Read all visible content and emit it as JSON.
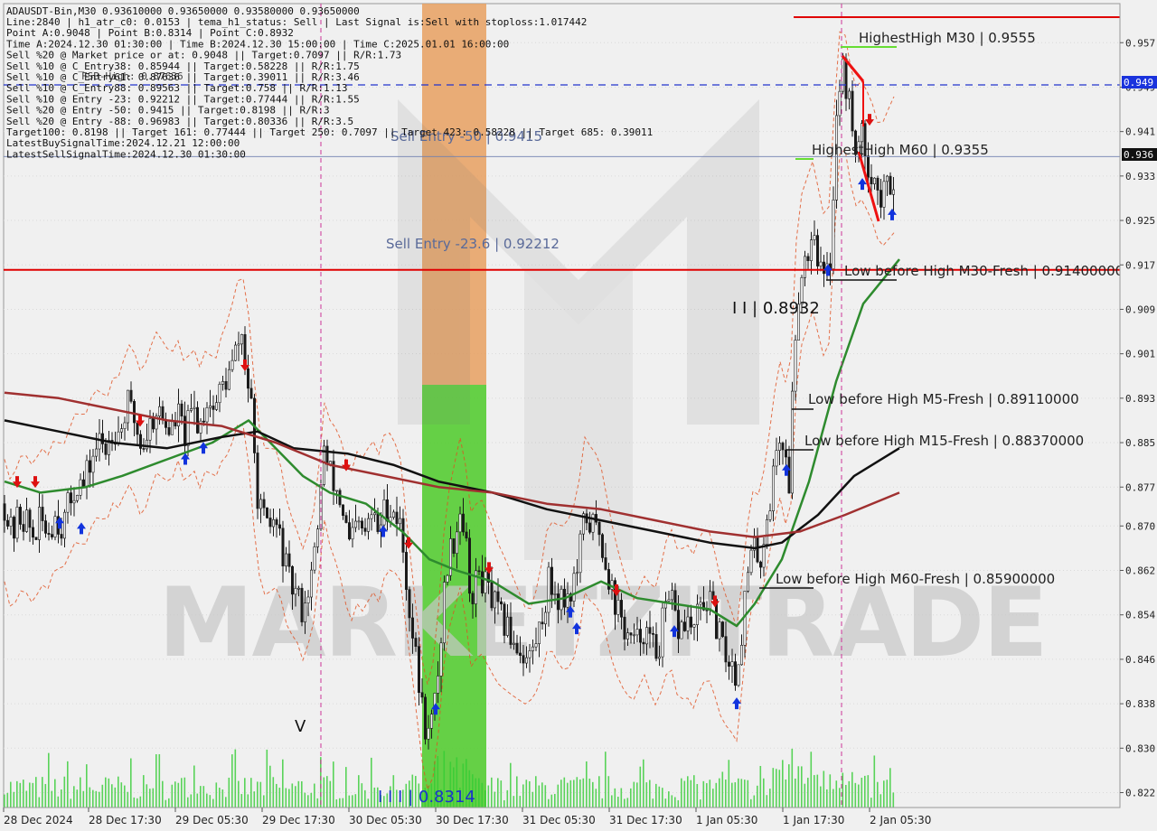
{
  "chart_header": {
    "symbol_line": "ADAUSDT-Bin,M30  0.93610000 0.93650000 0.93580000 0.93650000"
  },
  "info_lines": [
    "Line:2840 | h1_atr_c0: 0.0153 | tema_h1_status: Sell | Last Signal is:Sell with stoploss:1.017442",
    "Point A:0.9048 | Point B:0.8314 | Point C:0.8932",
    "Time A:2024.12.30 01:30:00 | Time B:2024.12.30 15:00:00 | Time C:2025.01.01 16:00:00",
    "Sell %20 @ Market price or at: 0.9048 || Target:0.7097 || R/R:1.73",
    "Sell %10 @ C_Entry38: 0.85944 || Target:0.58228 || R/R:1.75",
    "Sell %10 @ C_Entry61: 0.87636 || Target:0.39011 || R/R:3.46",
    "Sell %10 @ C_Entry88: 0.89563 || Target:0.758 || R/R:1.13",
    "Sell %10 @ Entry -23: 0.92212 || Target:0.77444 || R/R:1.55",
    "Sell %20 @ Entry -50: 0.9415 || Target:0.8198 || R/R:3",
    "Sell %20 @ Entry -88: 0.96983 || Target:0.80336 || R/R:3.5",
    "Target100: 0.8198 || Target 161: 0.77444 || Target 250: 0.7097 || Target 423: 0.58228 || Target 685: 0.39011",
    "LatestBuySignalTime:2024.12.21 12:00:00",
    "LatestSellSignalTime:2024.12.30 01:30:00"
  ],
  "overlap_text": "FSB-High: 0.87636",
  "watermark": "MARKETZITRADE",
  "annotations": {
    "highest_high_m30": "HighestHigh   M30 | 0.9555",
    "highest_high_m60": "HighestHigh   M60 | 0.9355",
    "sell_entry_50": "Sell Entry -50 | 0.9415",
    "sell_entry_23": "Sell Entry -23.6 | 0.92212",
    "low_before_high_m30": "Low before High   M30-Fresh | 0.91400000",
    "point_c": "I I | 0.8932",
    "low_before_high_m5": "Low before High   M5-Fresh | 0.89110000",
    "low_before_high_m15": "Low before High   M15-Fresh | 0.88370000",
    "low_before_high_m60": "Low before High   M60-Fresh | 0.85900000",
    "point_b": "I I I | 0.8314",
    "point_v": "V"
  },
  "price_tags": {
    "dashed_level": "0.949",
    "current_price": "0.936"
  },
  "colors": {
    "background": "#f0f0f0",
    "grid": "#d9d9d9",
    "candles": "#1a1a1a",
    "ema_fast": "#2e8b2e",
    "ema_mid": "#111111",
    "ema_slow": "#a03030",
    "sell_level": "#e00000",
    "dashed_level": "#2233cc",
    "orange_zone": "#e8a060",
    "green_zone": "#55cc33",
    "volume": "#33cc33",
    "buy_arrow": "#1133dd",
    "sell_arrow": "#dd1111",
    "envelope": "#e05020",
    "time_separator": "#cc3399"
  },
  "chart_data": {
    "type": "candlestick",
    "symbol": "ADAUSDT-Bin",
    "timeframe": "M30",
    "ohlc_last": {
      "open": 0.9361,
      "high": 0.9365,
      "low": 0.9358,
      "close": 0.9365
    },
    "ylim": [
      0.818,
      0.9615
    ],
    "y_ticks": [
      "0.957",
      "0.949",
      "0.941",
      "0.933",
      "0.925",
      "0.917",
      "0.909",
      "0.901",
      "0.893",
      "0.885",
      "0.877",
      "0.870",
      "0.862",
      "0.854",
      "0.846",
      "0.838",
      "0.830",
      "0.822"
    ],
    "y_tick_values": [
      0.957,
      0.949,
      0.941,
      0.933,
      0.925,
      0.917,
      0.909,
      0.901,
      0.893,
      0.885,
      0.877,
      0.87,
      0.862,
      0.854,
      0.846,
      0.838,
      0.83,
      0.822
    ],
    "x_ticks": [
      "28 Dec 2024",
      "28 Dec 17:30",
      "29 Dec 05:30",
      "29 Dec 17:30",
      "30 Dec 05:30",
      "30 Dec 17:30",
      "31 Dec 05:30",
      "31 Dec 17:30",
      "1 Jan 05:30",
      "1 Jan 17:30",
      "2 Jan 05:30"
    ],
    "levels": [
      {
        "value": 0.9616,
        "style": "solid",
        "color": "#e00000"
      },
      {
        "value": 0.9494,
        "style": "dashed",
        "color": "#2233cc"
      },
      {
        "value": 0.9365,
        "style": "thin",
        "color": "#7080b0"
      },
      {
        "value": 0.91611,
        "style": "solid",
        "color": "#e00000"
      }
    ],
    "close_path": [
      [
        0,
        0.874
      ],
      [
        8,
        0.868
      ],
      [
        16,
        0.872
      ],
      [
        24,
        0.871
      ],
      [
        32,
        0.868
      ],
      [
        40,
        0.871
      ],
      [
        48,
        0.869
      ],
      [
        56,
        0.872
      ],
      [
        64,
        0.87
      ],
      [
        72,
        0.874
      ],
      [
        80,
        0.878
      ],
      [
        88,
        0.877
      ],
      [
        96,
        0.882
      ],
      [
        104,
        0.885
      ],
      [
        112,
        0.884
      ],
      [
        120,
        0.888
      ],
      [
        128,
        0.887
      ],
      [
        136,
        0.892
      ],
      [
        144,
        0.889
      ],
      [
        152,
        0.884
      ],
      [
        160,
        0.888
      ],
      [
        168,
        0.891
      ],
      [
        176,
        0.889
      ],
      [
        184,
        0.887
      ],
      [
        192,
        0.89
      ],
      [
        200,
        0.886
      ],
      [
        208,
        0.891
      ],
      [
        216,
        0.888
      ],
      [
        224,
        0.893
      ],
      [
        232,
        0.891
      ],
      [
        240,
        0.895
      ],
      [
        248,
        0.897
      ],
      [
        256,
        0.901
      ],
      [
        262,
        0.905
      ],
      [
        266,
        0.899
      ],
      [
        272,
        0.893
      ],
      [
        278,
        0.878
      ],
      [
        284,
        0.872
      ],
      [
        290,
        0.869
      ],
      [
        298,
        0.871
      ],
      [
        306,
        0.867
      ],
      [
        314,
        0.86
      ],
      [
        322,
        0.858
      ],
      [
        330,
        0.855
      ],
      [
        338,
        0.86
      ],
      [
        346,
        0.867
      ],
      [
        352,
        0.885
      ],
      [
        358,
        0.88
      ],
      [
        366,
        0.877
      ],
      [
        374,
        0.873
      ],
      [
        382,
        0.866
      ],
      [
        390,
        0.87
      ],
      [
        398,
        0.868
      ],
      [
        406,
        0.872
      ],
      [
        414,
        0.869
      ],
      [
        422,
        0.874
      ],
      [
        430,
        0.873
      ],
      [
        438,
        0.87
      ],
      [
        446,
        0.858
      ],
      [
        452,
        0.85
      ],
      [
        458,
        0.842
      ],
      [
        464,
        0.835
      ],
      [
        470,
        0.832
      ],
      [
        476,
        0.838
      ],
      [
        482,
        0.848
      ],
      [
        488,
        0.862
      ],
      [
        494,
        0.866
      ],
      [
        500,
        0.87
      ],
      [
        506,
        0.874
      ],
      [
        512,
        0.864
      ],
      [
        518,
        0.856
      ],
      [
        524,
        0.862
      ],
      [
        530,
        0.86
      ],
      [
        538,
        0.857
      ],
      [
        546,
        0.854
      ],
      [
        554,
        0.852
      ],
      [
        562,
        0.85
      ],
      [
        570,
        0.848
      ],
      [
        578,
        0.846
      ],
      [
        586,
        0.848
      ],
      [
        594,
        0.853
      ],
      [
        602,
        0.86
      ],
      [
        610,
        0.858
      ],
      [
        618,
        0.857
      ],
      [
        626,
        0.858
      ],
      [
        634,
        0.862
      ],
      [
        642,
        0.872
      ],
      [
        650,
        0.87
      ],
      [
        658,
        0.869
      ],
      [
        666,
        0.863
      ],
      [
        674,
        0.857
      ],
      [
        682,
        0.853
      ],
      [
        690,
        0.85
      ],
      [
        698,
        0.848
      ],
      [
        706,
        0.852
      ],
      [
        714,
        0.849
      ],
      [
        722,
        0.847
      ],
      [
        730,
        0.854
      ],
      [
        738,
        0.856
      ],
      [
        746,
        0.851
      ],
      [
        754,
        0.853
      ],
      [
        762,
        0.851
      ],
      [
        770,
        0.855
      ],
      [
        778,
        0.857
      ],
      [
        786,
        0.853
      ],
      [
        794,
        0.848
      ],
      [
        802,
        0.846
      ],
      [
        810,
        0.843
      ],
      [
        816,
        0.852
      ],
      [
        822,
        0.861
      ],
      [
        828,
        0.866
      ],
      [
        836,
        0.864
      ],
      [
        844,
        0.872
      ],
      [
        850,
        0.878
      ],
      [
        856,
        0.887
      ],
      [
        862,
        0.884
      ],
      [
        868,
        0.878
      ],
      [
        874,
        0.903
      ],
      [
        878,
        0.912
      ],
      [
        884,
        0.918
      ],
      [
        890,
        0.92
      ],
      [
        896,
        0.924
      ],
      [
        902,
        0.916
      ],
      [
        908,
        0.914
      ],
      [
        914,
        0.918
      ],
      [
        920,
        0.944
      ],
      [
        926,
        0.953
      ],
      [
        932,
        0.949
      ],
      [
        938,
        0.941
      ],
      [
        944,
        0.938
      ],
      [
        950,
        0.94
      ],
      [
        956,
        0.935
      ],
      [
        962,
        0.933
      ],
      [
        968,
        0.928
      ],
      [
        974,
        0.93
      ],
      [
        980,
        0.932
      ],
      [
        986,
        0.934
      ],
      [
        990,
        0.9365
      ]
    ],
    "indicators": [
      {
        "points": [
          [
            0,
            0.878
          ],
          [
            40,
            0.876
          ],
          [
            90,
            0.877
          ],
          [
            130,
            0.879
          ],
          [
            180,
            0.882
          ],
          [
            230,
            0.885
          ],
          [
            270,
            0.889
          ],
          [
            300,
            0.884
          ],
          [
            330,
            0.879
          ],
          [
            360,
            0.876
          ],
          [
            400,
            0.874
          ],
          [
            440,
            0.869
          ],
          [
            470,
            0.864
          ],
          [
            500,
            0.862
          ],
          [
            540,
            0.86
          ],
          [
            580,
            0.856
          ],
          [
            620,
            0.857
          ],
          [
            660,
            0.86
          ],
          [
            700,
            0.857
          ],
          [
            740,
            0.856
          ],
          [
            780,
            0.855
          ],
          [
            810,
            0.852
          ],
          [
            830,
            0.856
          ],
          [
            860,
            0.864
          ],
          [
            890,
            0.878
          ],
          [
            920,
            0.896
          ],
          [
            950,
            0.91
          ],
          [
            990,
            0.918
          ]
        ]
      },
      {
        "points": [
          [
            0,
            0.889
          ],
          [
            60,
            0.887
          ],
          [
            120,
            0.885
          ],
          [
            180,
            0.884
          ],
          [
            240,
            0.886
          ],
          [
            280,
            0.887
          ],
          [
            320,
            0.884
          ],
          [
            380,
            0.883
          ],
          [
            430,
            0.881
          ],
          [
            480,
            0.878
          ],
          [
            540,
            0.876
          ],
          [
            600,
            0.873
          ],
          [
            660,
            0.871
          ],
          [
            720,
            0.869
          ],
          [
            780,
            0.867
          ],
          [
            830,
            0.866
          ],
          [
            860,
            0.867
          ],
          [
            900,
            0.872
          ],
          [
            940,
            0.879
          ],
          [
            990,
            0.884
          ]
        ]
      },
      {
        "points": [
          [
            0,
            0.894
          ],
          [
            60,
            0.893
          ],
          [
            120,
            0.891
          ],
          [
            180,
            0.889
          ],
          [
            240,
            0.888
          ],
          [
            300,
            0.885
          ],
          [
            360,
            0.881
          ],
          [
            420,
            0.879
          ],
          [
            480,
            0.877
          ],
          [
            540,
            0.876
          ],
          [
            600,
            0.874
          ],
          [
            660,
            0.873
          ],
          [
            720,
            0.871
          ],
          [
            780,
            0.869
          ],
          [
            830,
            0.868
          ],
          [
            880,
            0.869
          ],
          [
            930,
            0.872
          ],
          [
            990,
            0.876
          ]
        ]
      }
    ],
    "zones": [
      {
        "from": 0.8932,
        "to": 0.9616,
        "color": "orange",
        "time_range": [
          "30 Dec 05:30",
          "30 Dec 17:30"
        ]
      },
      {
        "from": 0.8183,
        "to": 0.8932,
        "color": "green",
        "time_range": [
          "30 Dec 05:30",
          "30 Dec 17:30"
        ]
      }
    ],
    "markers": [
      {
        "type": "buy",
        "price": 0.8705
      },
      {
        "type": "buy",
        "price": 0.8695
      },
      {
        "type": "buy",
        "price": 0.882
      },
      {
        "type": "buy",
        "price": 0.884
      },
      {
        "type": "buy",
        "price": 0.869
      },
      {
        "type": "buy",
        "price": 0.837
      },
      {
        "type": "buy",
        "price": 0.8545
      },
      {
        "type": "buy",
        "price": 0.8515
      },
      {
        "type": "buy",
        "price": 0.851
      },
      {
        "type": "buy",
        "price": 0.838
      },
      {
        "type": "buy",
        "price": 0.88
      },
      {
        "type": "buy",
        "price": 0.916
      },
      {
        "type": "buy",
        "price": 0.9315
      },
      {
        "type": "buy",
        "price": 0.926
      },
      {
        "type": "sell",
        "price": 0.878
      },
      {
        "type": "sell",
        "price": 0.878
      },
      {
        "type": "sell",
        "price": 0.889
      },
      {
        "type": "sell",
        "price": 0.899
      },
      {
        "type": "sell",
        "price": 0.881
      },
      {
        "type": "sell",
        "price": 0.867
      },
      {
        "type": "sell",
        "price": 0.8625
      },
      {
        "type": "sell",
        "price": 0.8585
      },
      {
        "type": "sell",
        "price": 0.8565
      },
      {
        "type": "sell",
        "price": 0.9432
      }
    ]
  }
}
